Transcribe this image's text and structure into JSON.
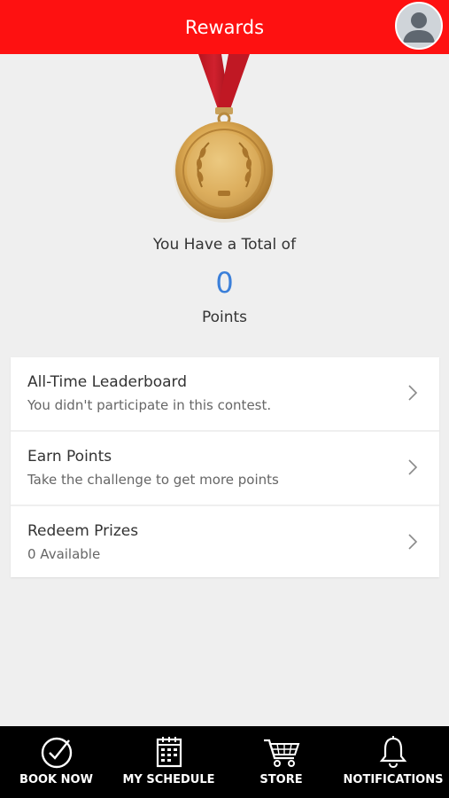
{
  "header": {
    "title": "Rewards",
    "profile_icon": "user-avatar-icon"
  },
  "colors": {
    "header_bg": "#fe1111",
    "points_value": "#3b7fd9",
    "nav_bg": "#000000",
    "page_bg": "#efefef"
  },
  "summary": {
    "medal_icon": "gold-medal-icon",
    "total_text": "You Have a Total of",
    "points_value": "0",
    "points_label": "Points"
  },
  "menu": [
    {
      "title": "All-Time Leaderboard",
      "subtitle": "You didn't participate in this contest.",
      "icon": "chevron-right-icon"
    },
    {
      "title": "Earn Points",
      "subtitle": "Take the challenge to get more points",
      "icon": "chevron-right-icon"
    },
    {
      "title": "Redeem Prizes",
      "subtitle": "0 Available",
      "icon": "chevron-right-icon"
    }
  ],
  "bottom_nav": [
    {
      "label": "BOOK NOW",
      "icon": "check-circle-icon"
    },
    {
      "label": "MY SCHEDULE",
      "icon": "calendar-icon"
    },
    {
      "label": "STORE",
      "icon": "cart-icon"
    },
    {
      "label": "NOTIFICATIONS",
      "icon": "bell-icon"
    }
  ]
}
